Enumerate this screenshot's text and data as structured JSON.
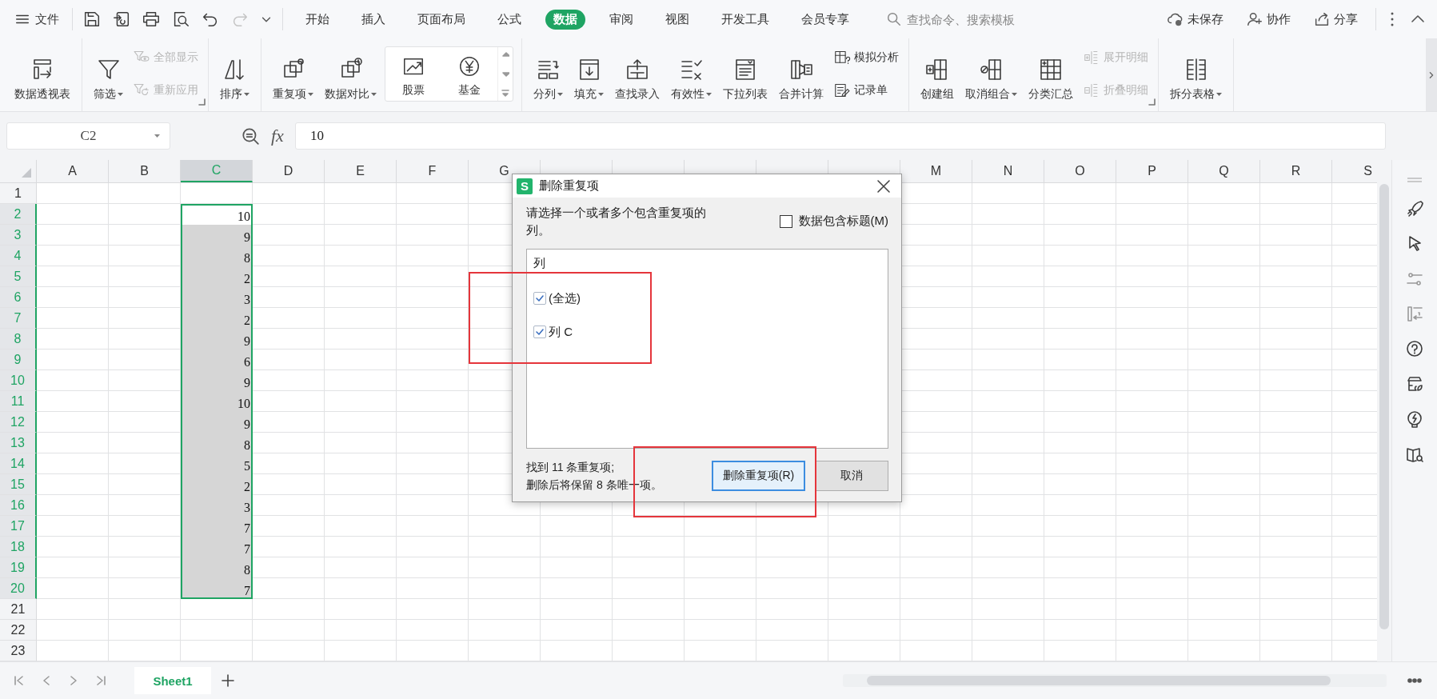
{
  "menu_bar": {
    "file": "文件",
    "quick_access": [
      {
        "disabled": false
      },
      {
        "disabled": false
      },
      {
        "disabled": false
      },
      {
        "disabled": false
      },
      {
        "disabled": false
      },
      {
        "disabled": true
      }
    ],
    "tabs": [
      {
        "label": "开始",
        "selected": false
      },
      {
        "label": "插入",
        "selected": false
      },
      {
        "label": "页面布局",
        "selected": false
      },
      {
        "label": "公式",
        "selected": false
      },
      {
        "label": "数据",
        "selected": true
      },
      {
        "label": "审阅",
        "selected": false
      },
      {
        "label": "视图",
        "selected": false
      },
      {
        "label": "开发工具",
        "selected": false
      },
      {
        "label": "会员专享",
        "selected": false
      }
    ],
    "search": {
      "placeholder": "查找命令、搜索模板"
    },
    "actions": [
      "未保存",
      "协作",
      "分享"
    ]
  },
  "ribbon": {
    "groups": [
      {
        "launcher": false,
        "tools": [
          {
            "kind": "large",
            "label": "数据透视表",
            "dropdown": false,
            "disabled": false
          }
        ]
      },
      {
        "launcher": true,
        "tools": [
          {
            "kind": "large",
            "label": "筛选",
            "dropdown": true,
            "disabled": false
          },
          {
            "kind": "stack",
            "items": [
              {
                "label": "全部显示",
                "disabled": true
              },
              {
                "label": "重新应用",
                "disabled": true
              }
            ]
          }
        ]
      },
      {
        "launcher": false,
        "tools": [
          {
            "kind": "large",
            "label": "排序",
            "dropdown": true,
            "disabled": false
          }
        ]
      },
      {
        "launcher": false,
        "tools": [
          {
            "kind": "large",
            "label": "重复项",
            "dropdown": true,
            "disabled": false
          },
          {
            "kind": "large",
            "label": "数据对比",
            "dropdown": true,
            "disabled": false
          },
          {
            "kind": "gallery",
            "items": [
              {
                "label": "股票"
              },
              {
                "label": "基金"
              }
            ]
          }
        ]
      },
      {
        "launcher": false,
        "tools": [
          {
            "kind": "large",
            "label": "分列",
            "dropdown": true,
            "disabled": false
          },
          {
            "kind": "large",
            "label": "填充",
            "dropdown": true,
            "disabled": false
          },
          {
            "kind": "large",
            "label": "查找录入",
            "dropdown": false,
            "disabled": false
          },
          {
            "kind": "large",
            "label": "有效性",
            "dropdown": true,
            "disabled": false
          },
          {
            "kind": "large",
            "label": "下拉列表",
            "dropdown": false,
            "disabled": false
          },
          {
            "kind": "large",
            "label": "合并计算",
            "dropdown": false,
            "disabled": false
          },
          {
            "kind": "stack",
            "items": [
              {
                "label": "模拟分析",
                "disabled": false
              },
              {
                "label": "记录单",
                "disabled": false
              }
            ]
          }
        ]
      },
      {
        "launcher": true,
        "tools": [
          {
            "kind": "large",
            "label": "创建组",
            "dropdown": false,
            "disabled": false
          },
          {
            "kind": "large",
            "label": "取消组合",
            "dropdown": true,
            "disabled": false
          },
          {
            "kind": "large",
            "label": "分类汇总",
            "dropdown": false,
            "disabled": false
          },
          {
            "kind": "stack",
            "items": [
              {
                "label": "展开明细",
                "disabled": true
              },
              {
                "label": "折叠明细",
                "disabled": true
              }
            ]
          }
        ]
      },
      {
        "launcher": false,
        "tools": [
          {
            "kind": "large",
            "label": "拆分表格",
            "dropdown": true,
            "disabled": false
          }
        ]
      }
    ]
  },
  "formula_bar": {
    "name_box": "C2",
    "fx": "fx",
    "formula": "10"
  },
  "sheet": {
    "columns": [
      {
        "label": "A",
        "selected": false
      },
      {
        "label": "B",
        "selected": false
      },
      {
        "label": "C",
        "selected": true
      },
      {
        "label": "D",
        "selected": false
      },
      {
        "label": "E",
        "selected": false
      },
      {
        "label": "F",
        "selected": false
      },
      {
        "label": "G",
        "selected": false
      },
      {
        "selected": false
      },
      {
        "selected": false
      },
      {
        "selected": false
      },
      {
        "selected": false
      },
      {
        "selected": false
      },
      {
        "label": "M",
        "selected": false
      },
      {
        "label": "N",
        "selected": false
      },
      {
        "label": "O",
        "selected": false
      },
      {
        "label": "P",
        "selected": false
      },
      {
        "label": "Q",
        "selected": false
      },
      {
        "label": "R",
        "selected": false
      },
      {
        "label": "S",
        "selected": false
      }
    ],
    "rows": [
      {
        "label": "1",
        "selected": false
      },
      {
        "label": "2",
        "selected": true,
        "cells": [
          null,
          null,
          {
            "value": "10",
            "selected": true,
            "active": true
          }
        ]
      },
      {
        "label": "3",
        "selected": true,
        "cells": [
          null,
          null,
          {
            "value": "9",
            "selected": true,
            "active": false
          }
        ]
      },
      {
        "label": "4",
        "selected": true,
        "cells": [
          null,
          null,
          {
            "value": "8",
            "selected": true,
            "active": false
          }
        ]
      },
      {
        "label": "5",
        "selected": true,
        "cells": [
          null,
          null,
          {
            "value": "2",
            "selected": true,
            "active": false
          }
        ]
      },
      {
        "label": "6",
        "selected": true,
        "cells": [
          null,
          null,
          {
            "value": "3",
            "selected": true,
            "active": false
          }
        ]
      },
      {
        "label": "7",
        "selected": true,
        "cells": [
          null,
          null,
          {
            "value": "2",
            "selected": true,
            "active": false
          }
        ]
      },
      {
        "label": "8",
        "selected": true,
        "cells": [
          null,
          null,
          {
            "value": "9",
            "selected": true,
            "active": false
          }
        ]
      },
      {
        "label": "9",
        "selected": true,
        "cells": [
          null,
          null,
          {
            "value": "6",
            "selected": true,
            "active": false
          }
        ]
      },
      {
        "label": "10",
        "selected": true,
        "cells": [
          null,
          null,
          {
            "value": "9",
            "selected": true,
            "active": false
          }
        ]
      },
      {
        "label": "11",
        "selected": true,
        "cells": [
          null,
          null,
          {
            "value": "10",
            "selected": true,
            "active": false
          }
        ]
      },
      {
        "label": "12",
        "selected": true,
        "cells": [
          null,
          null,
          {
            "value": "9",
            "selected": true,
            "active": false
          }
        ]
      },
      {
        "label": "13",
        "selected": true,
        "cells": [
          null,
          null,
          {
            "value": "8",
            "selected": true,
            "active": false
          }
        ]
      },
      {
        "label": "14",
        "selected": true,
        "cells": [
          null,
          null,
          {
            "value": "5",
            "selected": true,
            "active": false
          }
        ]
      },
      {
        "label": "15",
        "selected": true,
        "cells": [
          null,
          null,
          {
            "value": "2",
            "selected": true,
            "active": false
          }
        ]
      },
      {
        "label": "16",
        "selected": true,
        "cells": [
          null,
          null,
          {
            "value": "3",
            "selected": true,
            "active": false
          }
        ]
      },
      {
        "label": "17",
        "selected": true,
        "cells": [
          null,
          null,
          {
            "value": "7",
            "selected": true,
            "active": false
          }
        ]
      },
      {
        "label": "18",
        "selected": true,
        "cells": [
          null,
          null,
          {
            "value": "7",
            "selected": true,
            "active": false
          }
        ]
      },
      {
        "label": "19",
        "selected": true,
        "cells": [
          null,
          null,
          {
            "value": "8",
            "selected": true,
            "active": false
          }
        ]
      },
      {
        "label": "20",
        "selected": true,
        "cells": [
          null,
          null,
          {
            "value": "7",
            "selected": true,
            "active": false
          }
        ]
      },
      {
        "label": "21",
        "selected": false
      },
      {
        "label": "22",
        "selected": false
      },
      {
        "label": "23",
        "selected": false
      }
    ]
  },
  "sheet_tabs": [
    {
      "label": "Sheet1",
      "selected": true
    }
  ],
  "dialog": {
    "logo_letter": "S",
    "title": "删除重复项",
    "instruction": "请选择一个或者多个包含重复项的列。",
    "header_option": {
      "label": "数据包含标题(M)",
      "checked": false
    },
    "list_header": "列",
    "items": [
      {
        "label": "(全选)",
        "checked": true
      },
      {
        "label": "列 C",
        "checked": true
      }
    ],
    "status": [
      "找到 11 条重复项;",
      "删除后将保留 8 条唯一项。"
    ],
    "buttons": [
      {
        "label": "删除重复项(R)",
        "default": true
      },
      {
        "label": "取消",
        "default": false
      }
    ]
  }
}
